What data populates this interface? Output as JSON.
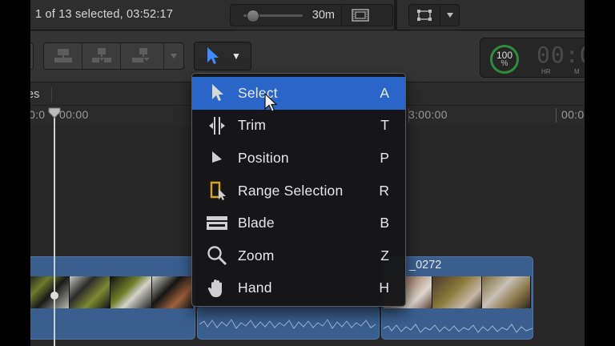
{
  "status": {
    "selection_text": "1 of 13 selected, 03:52:17"
  },
  "zoom": {
    "value_label": "30m",
    "slider_level": 0.1
  },
  "timecode": {
    "meter_value": "100",
    "meter_unit": "%",
    "digits": "00:0",
    "label_hr": "HR",
    "label_min": "M"
  },
  "index": {
    "label": "es"
  },
  "ruler": {
    "tc_start": "0:0",
    "tc_start2": "00:00",
    "tc_mid": "3:00:00",
    "tc_right": "00:0"
  },
  "clips": {
    "right_title": "_0272"
  },
  "tool_menu": {
    "items": [
      {
        "label": "Select",
        "key": "A",
        "icon": "arrow-icon",
        "active": true
      },
      {
        "label": "Trim",
        "key": "T",
        "icon": "trim-icon",
        "active": false
      },
      {
        "label": "Position",
        "key": "P",
        "icon": "position-icon",
        "active": false
      },
      {
        "label": "Range Selection",
        "key": "R",
        "icon": "range-selection-icon",
        "active": false
      },
      {
        "label": "Blade",
        "key": "B",
        "icon": "blade-icon",
        "active": false
      },
      {
        "label": "Zoom",
        "key": "Z",
        "icon": "zoom-icon",
        "active": false
      },
      {
        "label": "Hand",
        "key": "H",
        "icon": "hand-icon",
        "active": false
      }
    ]
  },
  "colors": {
    "menu_highlight": "#2a66c7",
    "tool_arrow": "#3d8bff",
    "clip_blue": "#3a5f8f",
    "meter_green": "#2e8d3c"
  }
}
